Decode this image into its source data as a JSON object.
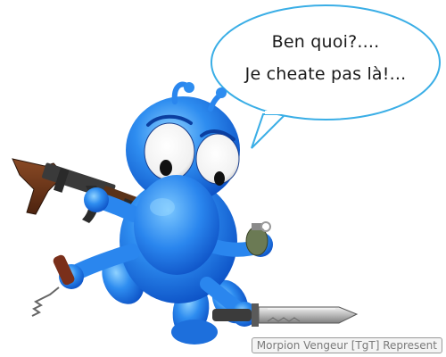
{
  "speech_bubble": {
    "line1": "Ben quoi?....",
    "line2": "Je cheate pas là!..."
  },
  "caption": "Morpion Vengeur [TgT] Represent",
  "colors": {
    "body_blue": "#2e8df0",
    "bubble_outline": "#3aaee6"
  },
  "icons": [
    "assault-rifle-icon",
    "grenade-icon",
    "combat-knife-icon",
    "corkscrew-icon"
  ]
}
